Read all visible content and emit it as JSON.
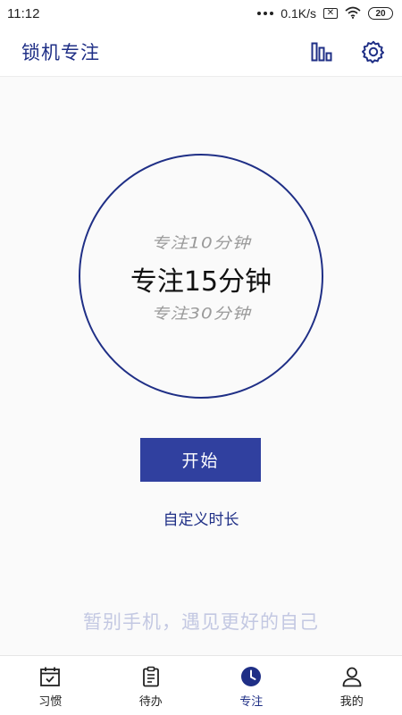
{
  "status_bar": {
    "time": "11:12",
    "network_speed": "0.1K/s",
    "sim_glyph": "✕",
    "battery": "20"
  },
  "header": {
    "title": "锁机专注",
    "stats_icon": "bar-chart-icon",
    "settings_icon": "gear-icon"
  },
  "picker": {
    "prev_option": "专注10分钟",
    "current_option": "专注15分钟",
    "next_option": "专注30分钟"
  },
  "actions": {
    "start_label": "开始",
    "custom_duration_label": "自定义时长"
  },
  "slogan": "暂别手机，遇见更好的自己",
  "bottom_nav": {
    "items": [
      {
        "label": "习惯",
        "icon": "calendar-check-icon",
        "active": false
      },
      {
        "label": "待办",
        "icon": "clipboard-icon",
        "active": false
      },
      {
        "label": "专注",
        "icon": "clock-icon",
        "active": true
      },
      {
        "label": "我的",
        "icon": "person-icon",
        "active": false
      }
    ]
  },
  "colors": {
    "accent": "#1f2f86",
    "button": "#30409f",
    "slogan": "#c3c8e2",
    "background": "#fafafa"
  }
}
